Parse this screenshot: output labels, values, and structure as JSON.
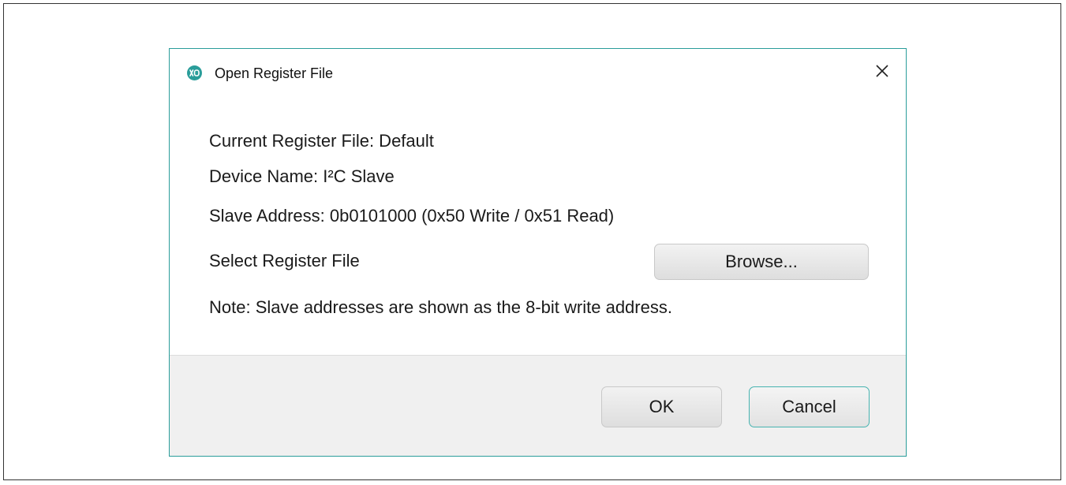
{
  "dialog": {
    "title": "Open Register File",
    "app_icon": "maxim-logo-icon",
    "close_icon": "close-icon",
    "accent_color": "#2a9d9a"
  },
  "info": {
    "current_register_file": "Current Register File: Default",
    "device_name": "Device Name: I²C Slave",
    "slave_address": "Slave Address: 0b0101000 (0x50 Write / 0x51 Read)",
    "select_register_file": "Select Register File",
    "note": "Note: Slave addresses are shown as the 8-bit write address."
  },
  "buttons": {
    "browse": "Browse...",
    "ok": "OK",
    "cancel": "Cancel"
  }
}
